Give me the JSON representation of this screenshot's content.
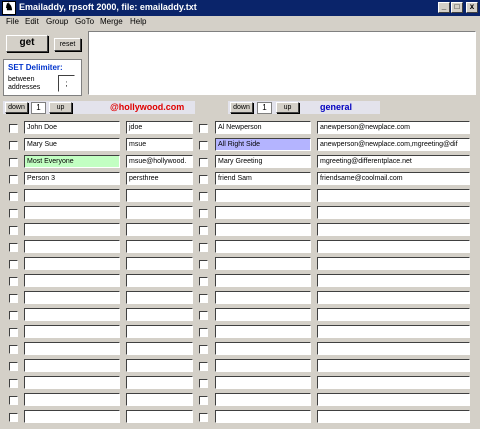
{
  "window": {
    "title": "Emailaddy, rpsoft 2000, file: emailaddy.txt",
    "icon_glyph": "♞",
    "minimize": "_",
    "maximize": "□",
    "close": "x"
  },
  "menu": [
    "File",
    "Edit",
    "Group",
    "GoTo",
    "Merge",
    "Help"
  ],
  "toolbar": {
    "get_label": "get",
    "reset_label": "reset"
  },
  "memo": {
    "value": ""
  },
  "delimiter": {
    "title": "SET Delimiter:",
    "line1": "between",
    "line2": "addresses",
    "value": ";"
  },
  "left_group": {
    "down": "down",
    "page": "1",
    "up": "up",
    "name": "@hollywood.com",
    "color": "#e00000"
  },
  "right_group": {
    "down": "down",
    "page": "1",
    "up": "up",
    "name": "general",
    "color": "#0000c0"
  },
  "left_rows": [
    {
      "name": "John Doe",
      "alias": "jdoe"
    },
    {
      "name": "Mary Sue",
      "alias": "msue"
    },
    {
      "name": "Most Everyone",
      "alias": "msue@hollywood."
    },
    {
      "name": "Person 3",
      "alias": "persthree"
    },
    {
      "name": "",
      "alias": ""
    },
    {
      "name": "",
      "alias": ""
    },
    {
      "name": "",
      "alias": ""
    },
    {
      "name": "",
      "alias": ""
    },
    {
      "name": "",
      "alias": ""
    },
    {
      "name": "",
      "alias": ""
    },
    {
      "name": "",
      "alias": ""
    },
    {
      "name": "",
      "alias": ""
    },
    {
      "name": "",
      "alias": ""
    },
    {
      "name": "",
      "alias": ""
    },
    {
      "name": "",
      "alias": ""
    },
    {
      "name": "",
      "alias": ""
    },
    {
      "name": "",
      "alias": ""
    },
    {
      "name": "",
      "alias": ""
    }
  ],
  "right_rows": [
    {
      "name": "Al Newperson",
      "email": "anewperson@newplace.com"
    },
    {
      "name": "All Right Side",
      "email": "anewperson@newplace.com,mgreeting@dif"
    },
    {
      "name": "Mary Greeting",
      "email": "mgreeting@differentplace.net"
    },
    {
      "name": "friend Sam",
      "email": "friendsame@coolmail.com"
    },
    {
      "name": "",
      "email": ""
    },
    {
      "name": "",
      "email": ""
    },
    {
      "name": "",
      "email": ""
    },
    {
      "name": "",
      "email": ""
    },
    {
      "name": "",
      "email": ""
    },
    {
      "name": "",
      "email": ""
    },
    {
      "name": "",
      "email": ""
    },
    {
      "name": "",
      "email": ""
    },
    {
      "name": "",
      "email": ""
    },
    {
      "name": "",
      "email": ""
    },
    {
      "name": "",
      "email": ""
    },
    {
      "name": "",
      "email": ""
    },
    {
      "name": "",
      "email": ""
    },
    {
      "name": "",
      "email": ""
    }
  ],
  "highlights": {
    "group_all_left": "#c2ffc2",
    "group_all_right": "#b4b4ff"
  }
}
